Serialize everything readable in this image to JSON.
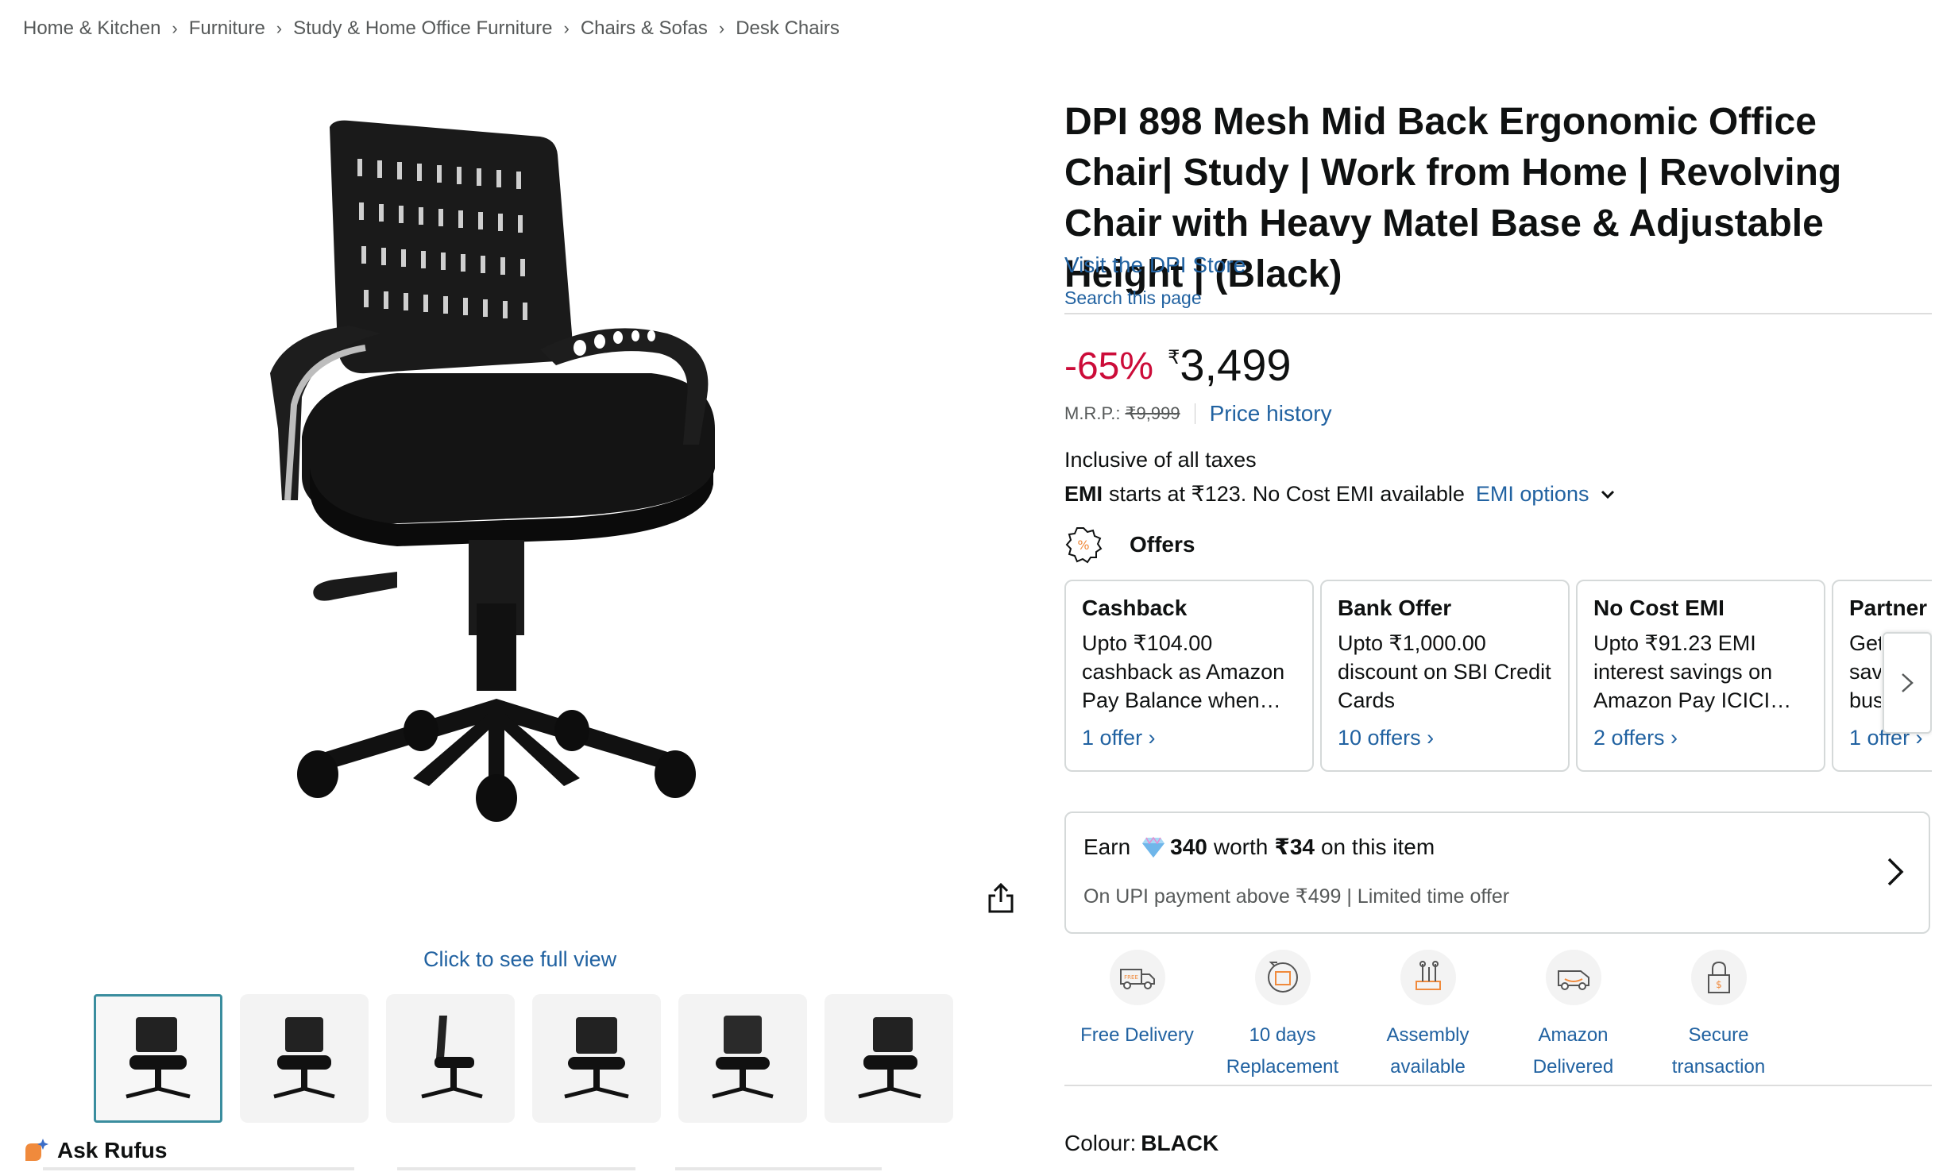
{
  "breadcrumb": [
    "Home & Kitchen",
    "Furniture",
    "Study & Home Office Furniture",
    "Chairs & Sofas",
    "Desk Chairs"
  ],
  "media": {
    "full_view_label": "Click to see full view",
    "thumbnail_count": 6,
    "ask_rufus_label": "Ask Rufus"
  },
  "product": {
    "title": "DPI 898 Mesh Mid Back Ergonomic Office Chair| Study | Work from Home | Revolving Chair with Heavy Matel Base & Adjustable Height | (Black)",
    "store_link": "Visit the DPI Store",
    "search_page": "Search this page"
  },
  "pricing": {
    "discount": "-65%",
    "currency_symbol": "₹",
    "price": "3,499",
    "mrp_label": "M.R.P.:",
    "mrp_value": "₹9,999",
    "price_history": "Price history",
    "taxes": "Inclusive of all taxes",
    "emi_bold": "EMI",
    "emi_text": "starts at ₹123. No Cost EMI available",
    "emi_options": "EMI options"
  },
  "offers": {
    "heading": "Offers",
    "cards": [
      {
        "title": "Cashback",
        "body": "Upto ₹104.00 cashback as Amazon Pay Balance when…",
        "link": "1 offer ›"
      },
      {
        "title": "Bank Offer",
        "body": "Upto ₹1,000.00 discount on SBI Credit Cards",
        "link": "10 offers ›"
      },
      {
        "title": "No Cost EMI",
        "body": "Upto ₹91.23 EMI interest savings on Amazon Pay ICICI…",
        "link": "2 offers ›"
      },
      {
        "title": "Partner",
        "body": "Get sav bus",
        "link": "1 offer ›"
      }
    ]
  },
  "earn": {
    "prefix": "Earn",
    "points": "340",
    "worth_text": "worth",
    "worth_value": "₹34",
    "suffix": "on this item",
    "subtext": "On UPI payment above ₹499 | Limited time offer"
  },
  "features": [
    {
      "label": "Free Delivery",
      "icon": "free-delivery-icon"
    },
    {
      "label": "10 days Replacement",
      "icon": "replacement-icon"
    },
    {
      "label": "Assembly available",
      "icon": "assembly-icon"
    },
    {
      "label": "Amazon Delivered",
      "icon": "amazon-delivered-icon"
    },
    {
      "label": "Secure transaction",
      "icon": "secure-transaction-icon"
    }
  ],
  "colour": {
    "label": "Colour:",
    "value": "BLACK"
  },
  "colors": {
    "link": "#2162a1",
    "discount": "#cc0c39",
    "text": "#0f1111",
    "muted": "#565959",
    "thumb_border": "#3a8d9e"
  }
}
